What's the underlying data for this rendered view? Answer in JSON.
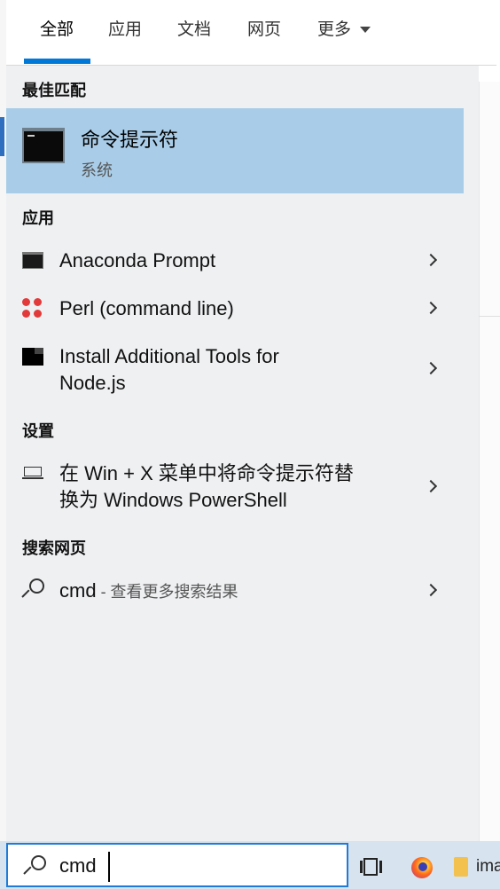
{
  "tabs": [
    {
      "label": "全部",
      "active": true
    },
    {
      "label": "应用"
    },
    {
      "label": "文档"
    },
    {
      "label": "网页"
    },
    {
      "label": "更多"
    }
  ],
  "best_match": {
    "header": "最佳匹配",
    "title": "命令提示符",
    "subtitle": "系统"
  },
  "apps": {
    "header": "应用",
    "items": [
      {
        "label": "Anaconda Prompt",
        "icon": "console-icon"
      },
      {
        "label": "Perl (command line)",
        "icon": "perl-icon"
      },
      {
        "label_line1": "Install Additional Tools for",
        "label_line2": "Node.js",
        "icon": "nodejs-tools-icon"
      }
    ]
  },
  "settings": {
    "header": "设置",
    "item_line1": "在 Win + X 菜单中将命令提示符替",
    "item_line2": "换为 Windows PowerShell",
    "icon": "laptop-icon"
  },
  "web": {
    "header": "搜索网页",
    "term": "cmd",
    "hint": " - 查看更多搜索结果",
    "icon": "search-icon"
  },
  "search_box": {
    "value": "cmd"
  },
  "taskbar": {
    "folder_label": "ima"
  },
  "colors": {
    "accent": "#0078d7",
    "selected_bg": "#a9cde8",
    "panel_bg": "#eef0f2"
  }
}
